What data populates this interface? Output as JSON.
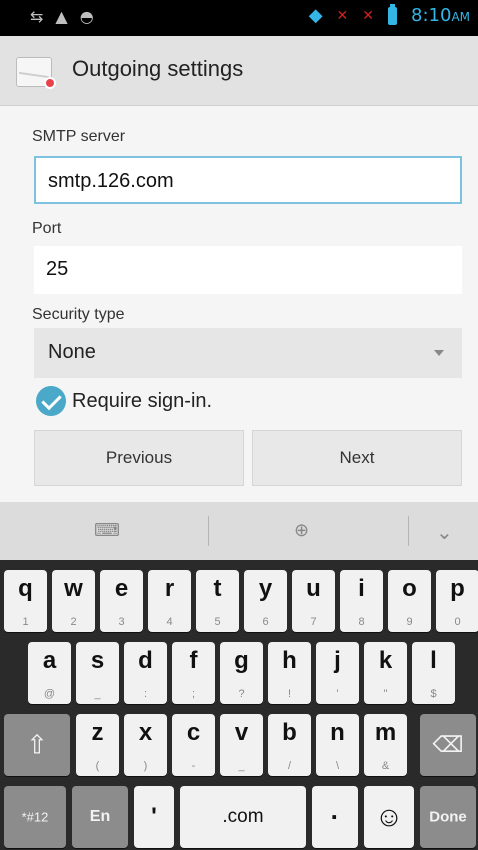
{
  "status_bar": {
    "icons_left": [
      "usb-icon",
      "warning-icon",
      "android-icon"
    ],
    "icons_right": [
      "wifi-icon",
      "signal-icon",
      "battery-icon"
    ],
    "time": "8:10",
    "ampm": "AM"
  },
  "action_bar": {
    "title": "Outgoing settings",
    "icon": "email-app-icon"
  },
  "form": {
    "smtp_label": "SMTP server",
    "smtp_value": "smtp.126.com",
    "port_label": "Port",
    "port_value": "25",
    "security_label": "Security type",
    "security_value": "None",
    "require_signin_label": "Require sign-in.",
    "require_signin_checked": true,
    "previous_label": "Previous",
    "next_label": "Next"
  },
  "keyboard": {
    "toolbar": [
      "keyboard-icon",
      "globe-icon",
      "chevron-down-icon"
    ],
    "row1": [
      {
        "k": "q",
        "s": "1"
      },
      {
        "k": "w",
        "s": "2"
      },
      {
        "k": "e",
        "s": "3"
      },
      {
        "k": "r",
        "s": "4"
      },
      {
        "k": "t",
        "s": "5"
      },
      {
        "k": "y",
        "s": "6"
      },
      {
        "k": "u",
        "s": "7"
      },
      {
        "k": "i",
        "s": "8"
      },
      {
        "k": "o",
        "s": "9"
      },
      {
        "k": "p",
        "s": "0"
      }
    ],
    "row2": [
      {
        "k": "a",
        "s": "@"
      },
      {
        "k": "s",
        "s": "_"
      },
      {
        "k": "d",
        "s": ":"
      },
      {
        "k": "f",
        "s": ";"
      },
      {
        "k": "g",
        "s": "?"
      },
      {
        "k": "h",
        "s": "!"
      },
      {
        "k": "j",
        "s": "'"
      },
      {
        "k": "k",
        "s": "\""
      },
      {
        "k": "l",
        "s": "$"
      }
    ],
    "row3": [
      {
        "k": "z",
        "s": "("
      },
      {
        "k": "x",
        "s": ")"
      },
      {
        "k": "c",
        "s": "-"
      },
      {
        "k": "v",
        "s": "_"
      },
      {
        "k": "b",
        "s": "/"
      },
      {
        "k": "n",
        "s": "\\"
      },
      {
        "k": "m",
        "s": "&"
      }
    ],
    "symbols_key": "*#12",
    "lang_key": "En",
    "comma_key": "'",
    "dotcom_key": ".com",
    "period_key": "·",
    "done_key": "Done"
  }
}
